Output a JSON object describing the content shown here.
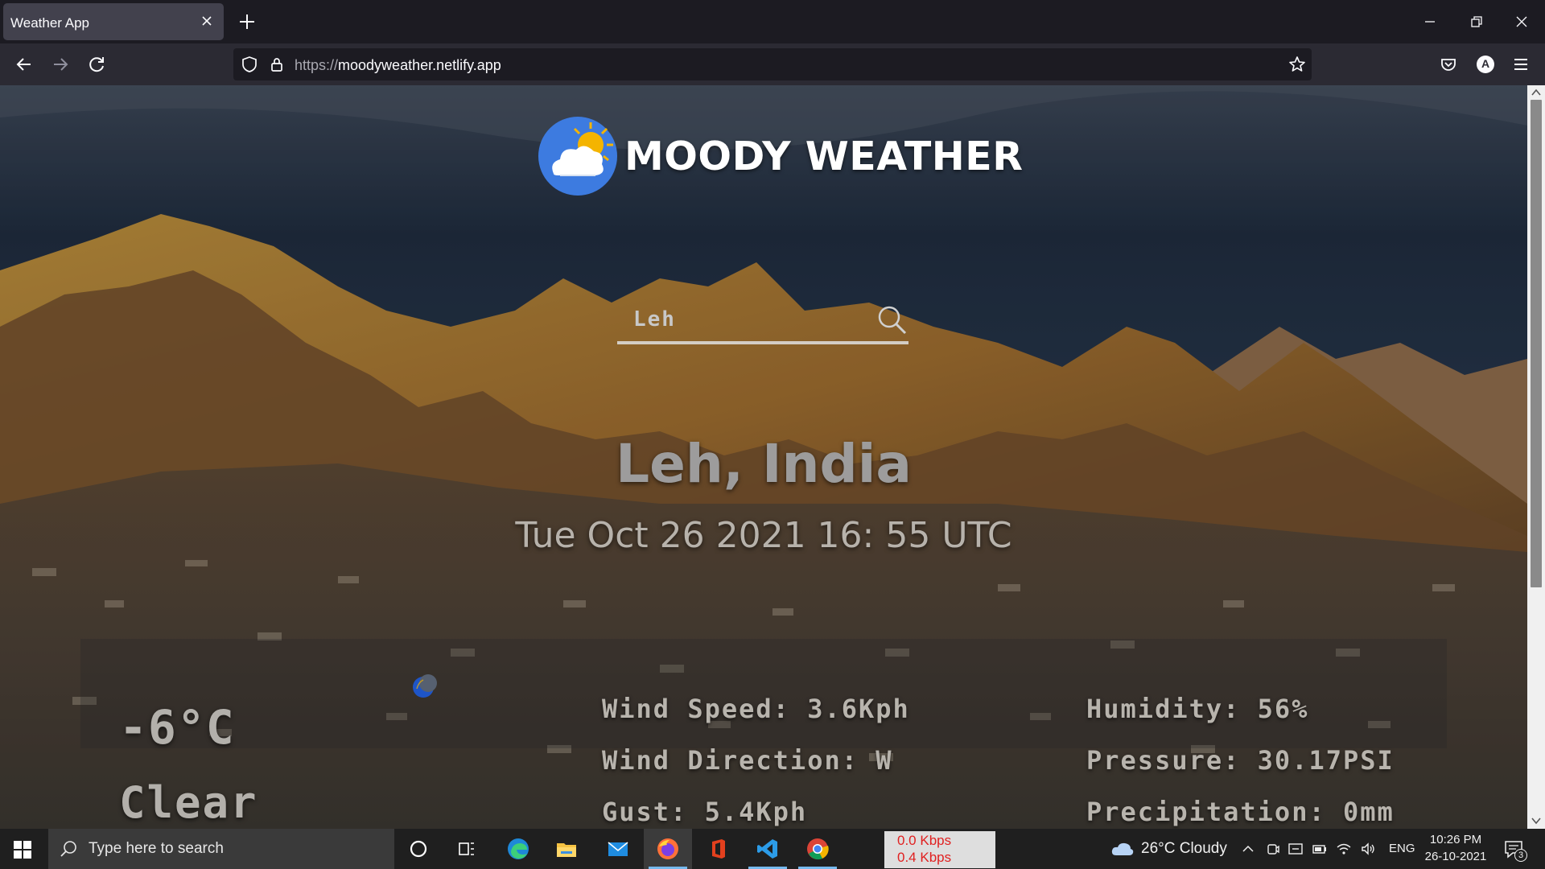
{
  "browser": {
    "tab_title": "Weather App",
    "url_scheme": "https://",
    "url_host": "moodyweather.netlify.app",
    "profile_letter": "A"
  },
  "app": {
    "logo_text": "MOODY WEATHER",
    "search_value": "Leh",
    "city": "Leh, India",
    "date": "Tue Oct 26 2021 16: 55 UTC",
    "temperature": "-6°C",
    "condition": "Clear",
    "stats_left": [
      "Wind Speed: 3.6Kph",
      "Wind Direction: W",
      "Gust: 5.4Kph"
    ],
    "stats_right": [
      "Humidity: 56%",
      "Pressure: 30.17PSI",
      "Precipitation: 0mm"
    ],
    "condition_icon": "moon-icon"
  },
  "taskbar": {
    "search_placeholder": "Type here to search",
    "net_down": "0.0 Kbps",
    "net_up": "0.4 Kbps",
    "weather": "26°C  Cloudy",
    "language": "ENG",
    "time": "10:26 PM",
    "date": "26-10-2021",
    "notification_count": "3"
  },
  "colors": {
    "chrome_bg": "#1c1b22",
    "toolbar_bg": "#2b2a33",
    "taskbar_bg": "#1f1f1f",
    "logo_blue": "#3d7be0",
    "sun_yellow": "#f4b400",
    "net_red": "#e02020"
  }
}
